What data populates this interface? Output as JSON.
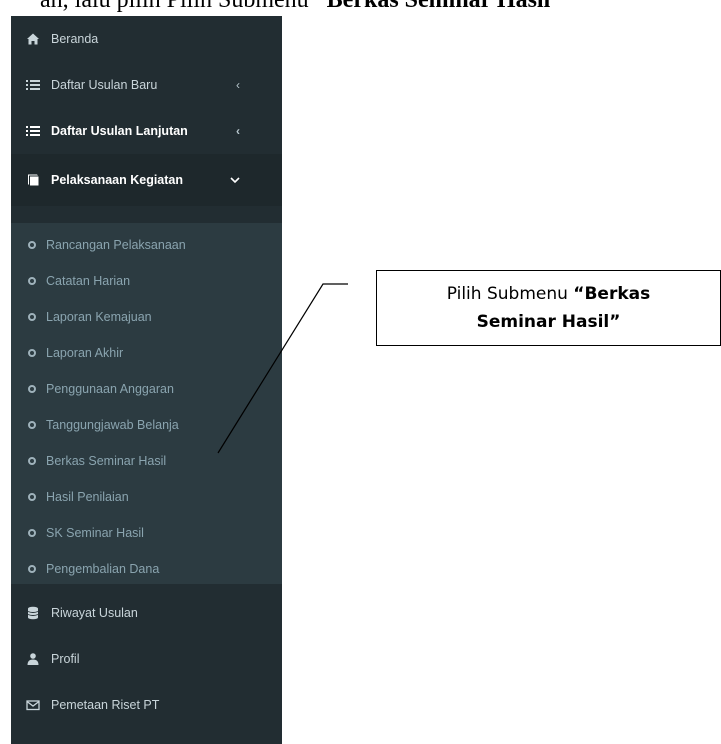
{
  "caption": {
    "prefix": "an, lalu pilih Pilih Submenu",
    "highlight": "“Berkas Seminar Hasil”"
  },
  "sidebar": {
    "items": [
      {
        "label": "Beranda",
        "icon": "home-icon"
      },
      {
        "label": "Daftar Usulan Baru",
        "icon": "list-icon",
        "chevron": "‹"
      },
      {
        "label": "Daftar Usulan Lanjutan",
        "icon": "list-icon",
        "chevron": "‹"
      },
      {
        "label": "Pelaksanaan Kegiatan",
        "icon": "book-icon",
        "chevron": "⌄"
      }
    ],
    "submenu": [
      "Rancangan Pelaksanaan",
      "Catatan Harian",
      "Laporan Kemajuan",
      "Laporan Akhir",
      "Penggunaan Anggaran",
      "Tanggungjawab Belanja",
      "Berkas Seminar Hasil",
      "Hasil Penilaian",
      "SK Seminar Hasil",
      "Pengembalian Dana"
    ],
    "bottom_items": [
      {
        "label": "Riwayat Usulan",
        "icon": "database-icon"
      },
      {
        "label": "Profil",
        "icon": "user-icon"
      },
      {
        "label": "Pemetaan Riset PT",
        "icon": "envelope-icon"
      }
    ]
  },
  "callout": {
    "line1_normal": "Pilih Submenu ",
    "line1_bold": "“Berkas",
    "line2_bold": "Seminar Hasil”"
  },
  "colors": {
    "sidebar_bg": "#222d32",
    "submenu_bg": "#2c3b41",
    "active_bg": "#1e282c"
  }
}
